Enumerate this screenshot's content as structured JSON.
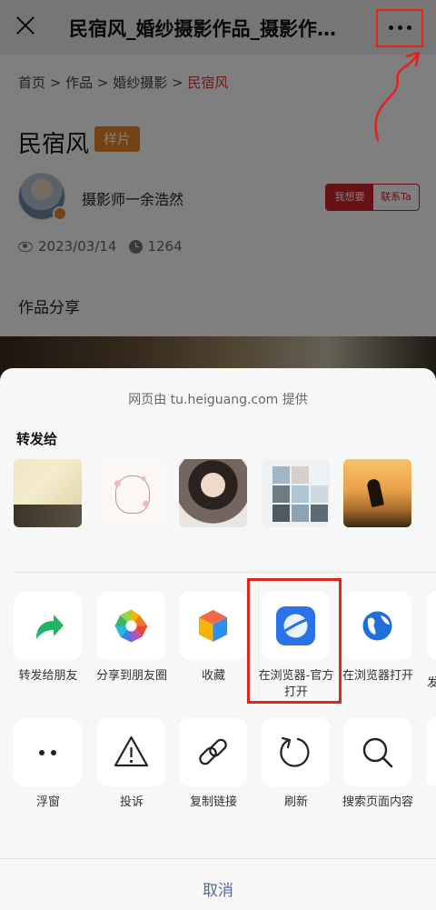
{
  "header": {
    "title": "民宿风_婚纱摄影作品_摄影作…",
    "close_icon": "close-icon",
    "more_icon": "more-dots-icon"
  },
  "page": {
    "breadcrumb": {
      "home": "首页",
      "works": "作品",
      "category": "婚纱摄影",
      "current": "民宿风",
      "separator": " > "
    },
    "work_title": "民宿风",
    "badge": "样片",
    "photographer": "摄影师一余浩然",
    "want_button": "我想要",
    "contact_button": "联系Ta",
    "date": "2023/03/14",
    "views": "1264",
    "section_heading": "作品分享"
  },
  "share_sheet": {
    "provider": "网页由 tu.heiguang.com 提供",
    "forward_to": "转发给",
    "row1": [
      {
        "label": "转发给朋友",
        "icon": "forward-arrow-icon"
      },
      {
        "label": "分享到朋友圈",
        "icon": "moments-icon"
      },
      {
        "label": "收藏",
        "icon": "favorite-cube-icon"
      },
      {
        "label": "在浏览器-官方打开",
        "icon": "official-browser-icon"
      },
      {
        "label": "在浏览器打开",
        "icon": "browser-globe-icon"
      }
    ],
    "row1_partial_text": "发",
    "row2": [
      {
        "label": "浮窗",
        "icon": "float-window-icon"
      },
      {
        "label": "投诉",
        "icon": "warning-icon"
      },
      {
        "label": "复制链接",
        "icon": "link-icon"
      },
      {
        "label": "刷新",
        "icon": "refresh-icon"
      },
      {
        "label": "搜索页面内容",
        "icon": "search-icon"
      }
    ],
    "cancel": "取消"
  },
  "colors": {
    "accent_red": "#e2231a",
    "badge_orange": "#e9862a",
    "cancel_blue": "#576b95",
    "sheet_bg": "#f7f7f7"
  }
}
